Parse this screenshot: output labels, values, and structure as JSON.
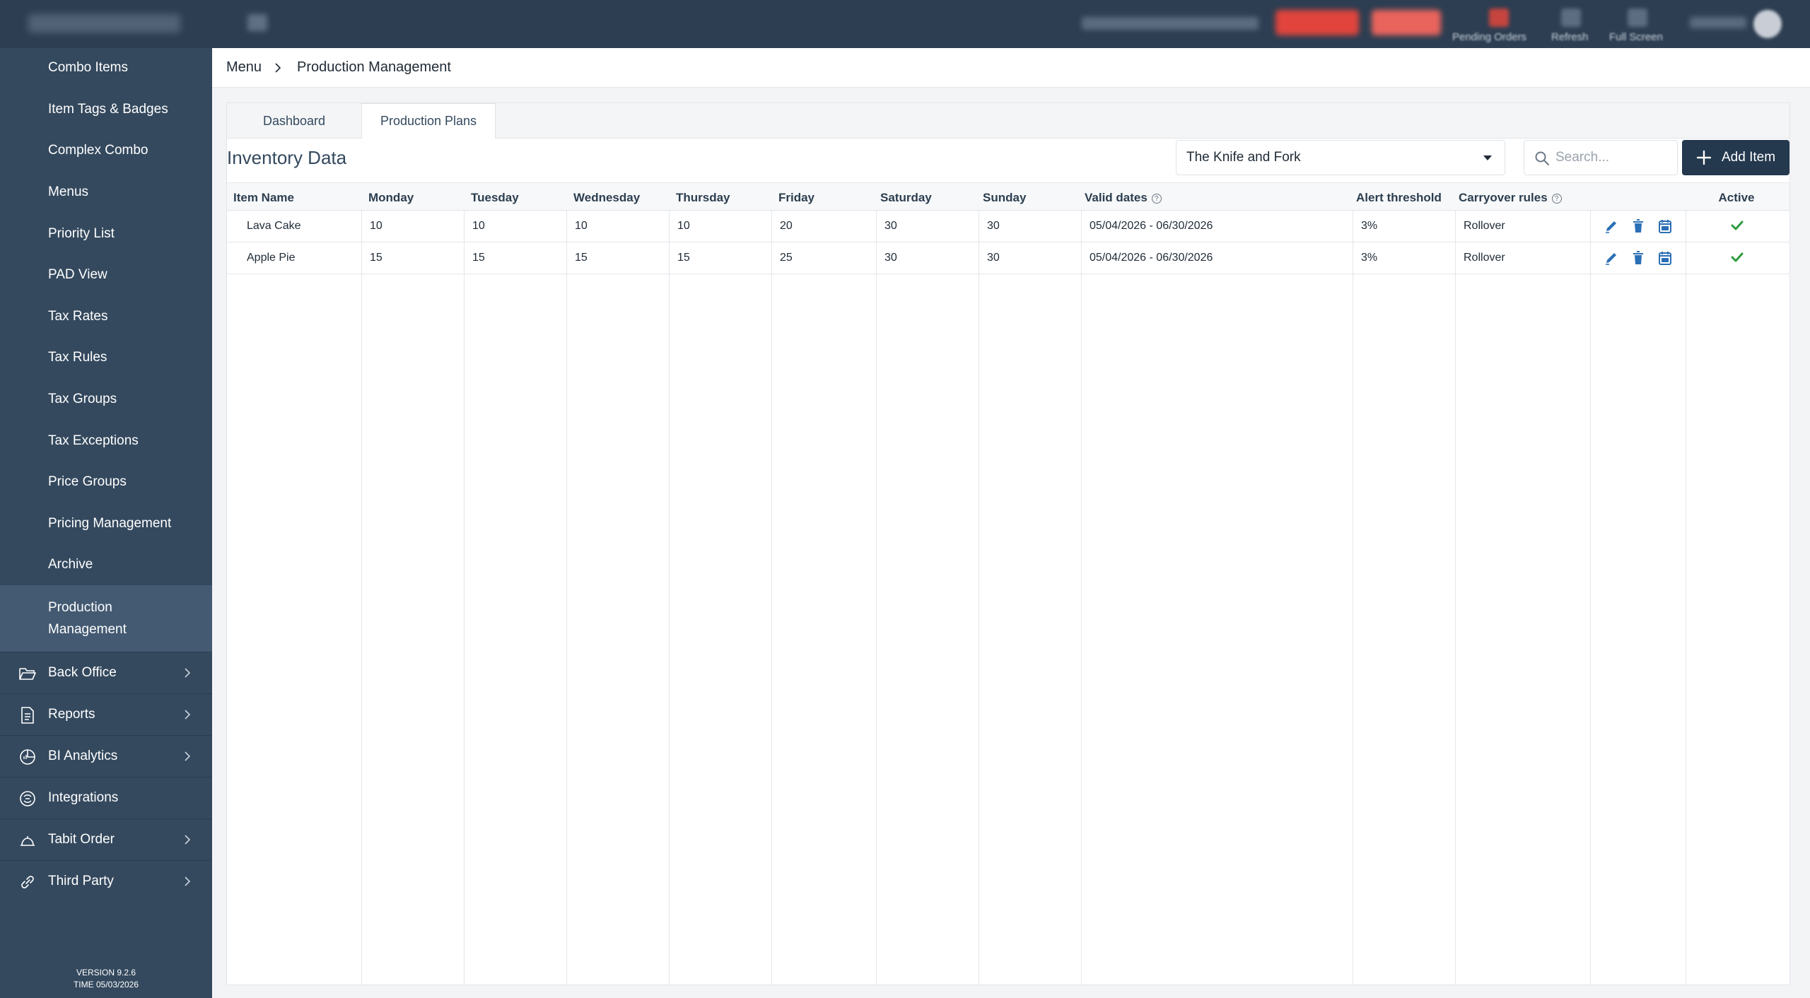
{
  "sidebar": {
    "items": [
      {
        "label": "Combo Items"
      },
      {
        "label": "Item Tags & Badges"
      },
      {
        "label": "Complex Combo"
      },
      {
        "label": "Menus"
      },
      {
        "label": "Priority List"
      },
      {
        "label": "PAD View"
      },
      {
        "label": "Tax Rates"
      },
      {
        "label": "Tax Rules"
      },
      {
        "label": "Tax Groups"
      },
      {
        "label": "Tax Exceptions"
      },
      {
        "label": "Price Groups"
      },
      {
        "label": "Pricing Management"
      },
      {
        "label": "Archive"
      },
      {
        "label": "Production\nManagement",
        "active": true
      }
    ],
    "groups": [
      {
        "label": "Back Office",
        "icon": "folder-open-icon",
        "expandable": true
      },
      {
        "label": "Reports",
        "icon": "document-icon",
        "expandable": true
      },
      {
        "label": "BI Analytics",
        "icon": "analytics-icon",
        "expandable": true
      },
      {
        "label": "Integrations",
        "icon": "integrations-icon",
        "expandable": false
      },
      {
        "label": "Tabit Order",
        "icon": "cloud-icon",
        "expandable": true
      },
      {
        "label": "Third Party",
        "icon": "link-icon",
        "expandable": true
      }
    ],
    "version_line": "VERSION 9.2.6",
    "time_line": "TIME 05/03/2026"
  },
  "topbar": {
    "labels": [
      "Pending Orders",
      "Refresh",
      "Full Screen"
    ]
  },
  "breadcrumb": {
    "root": "Menu",
    "current": "Production Management"
  },
  "tabs": [
    {
      "label": "Dashboard",
      "active": false
    },
    {
      "label": "Production Plans",
      "active": true
    }
  ],
  "toolbar": {
    "title": "Inventory Data",
    "location_select": "The Knife and Fork",
    "search_placeholder": "Search...",
    "add_label": "Add Item"
  },
  "table": {
    "columns": {
      "item_name": "Item Name",
      "monday": "Monday",
      "tuesday": "Tuesday",
      "wednesday": "Wednesday",
      "thursday": "Thursday",
      "friday": "Friday",
      "saturday": "Saturday",
      "sunday": "Sunday",
      "valid_dates": "Valid dates",
      "alert_threshold": "Alert threshold",
      "carryover_rules": "Carryover rules",
      "active": "Active"
    },
    "rows": [
      {
        "name": "Lava Cake",
        "mon": "10",
        "tue": "10",
        "wed": "10",
        "thu": "10",
        "fri": "20",
        "sat": "30",
        "sun": "30",
        "dates": "05/04/2026 - 06/30/2026",
        "threshold": "3%",
        "carryover": "Rollover",
        "active": true
      },
      {
        "name": "Apple Pie",
        "mon": "15",
        "tue": "15",
        "wed": "15",
        "thu": "15",
        "fri": "25",
        "sat": "30",
        "sun": "30",
        "dates": "05/04/2026 - 06/30/2026",
        "threshold": "3%",
        "carryover": "Rollover",
        "active": true
      }
    ]
  },
  "colors": {
    "sidebar_bg": "#34495e",
    "topbar_bg": "#2d3e52",
    "accent_blue": "#2a6fb5",
    "active_check": "#2e9a3f",
    "primary_button": "#24384e"
  }
}
